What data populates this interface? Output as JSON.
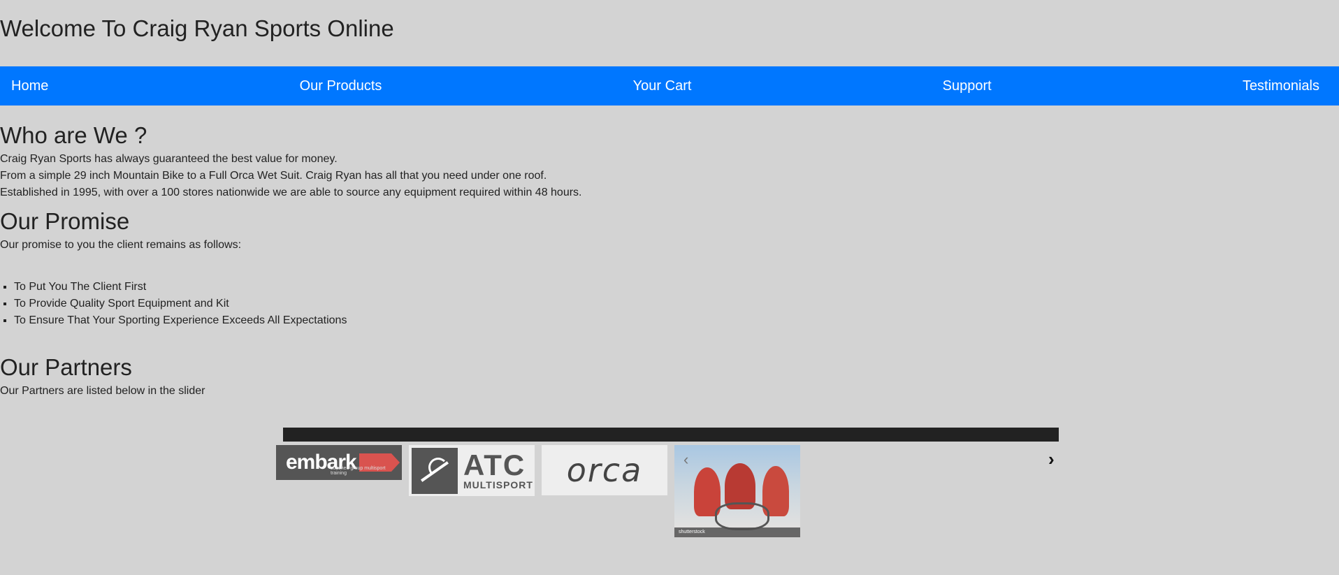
{
  "header": {
    "title": "Welcome To Craig Ryan Sports Online"
  },
  "nav": {
    "items": [
      {
        "label": "Home"
      },
      {
        "label": "Our Products"
      },
      {
        "label": "Your Cart"
      },
      {
        "label": "Support"
      },
      {
        "label": "Testimonials"
      }
    ]
  },
  "who": {
    "heading": "Who are We ?",
    "lines": [
      "Craig Ryan Sports has always guaranteed the best value for money.",
      "From a simple 29 inch Mountain Bike to a Full Orca Wet Suit. Craig Ryan has all that you need under one roof.",
      "Established in 1995, with over a 100 stores nationwide we are able to source any equipment required within 48 hours."
    ]
  },
  "promise": {
    "heading": "Our Promise",
    "intro": "Our promise to you the client remains as follows:",
    "items": [
      "To Put You The Client First",
      "To Provide Quality Sport Equipment and Kit",
      "To Ensure That Your Sporting Experience Exceeds All Expectations"
    ]
  },
  "partners": {
    "heading": "Our Partners",
    "intro": "Our Partners are listed below in the slider",
    "slider": {
      "prev_label": "‹",
      "next_label": "›",
      "slides": {
        "embark": {
          "logo_text": "embark",
          "tagline": "coached group multisport training"
        },
        "atc": {
          "logo_text": "ATC",
          "sub_text": "MULTISPORT"
        },
        "orca": {
          "logo_text": "orca"
        },
        "photo": {
          "watermark": "shutterstock"
        }
      }
    }
  },
  "colors": {
    "background": "#d3d3d3",
    "navbar": "#0077ff",
    "slider_bar": "#222222"
  }
}
